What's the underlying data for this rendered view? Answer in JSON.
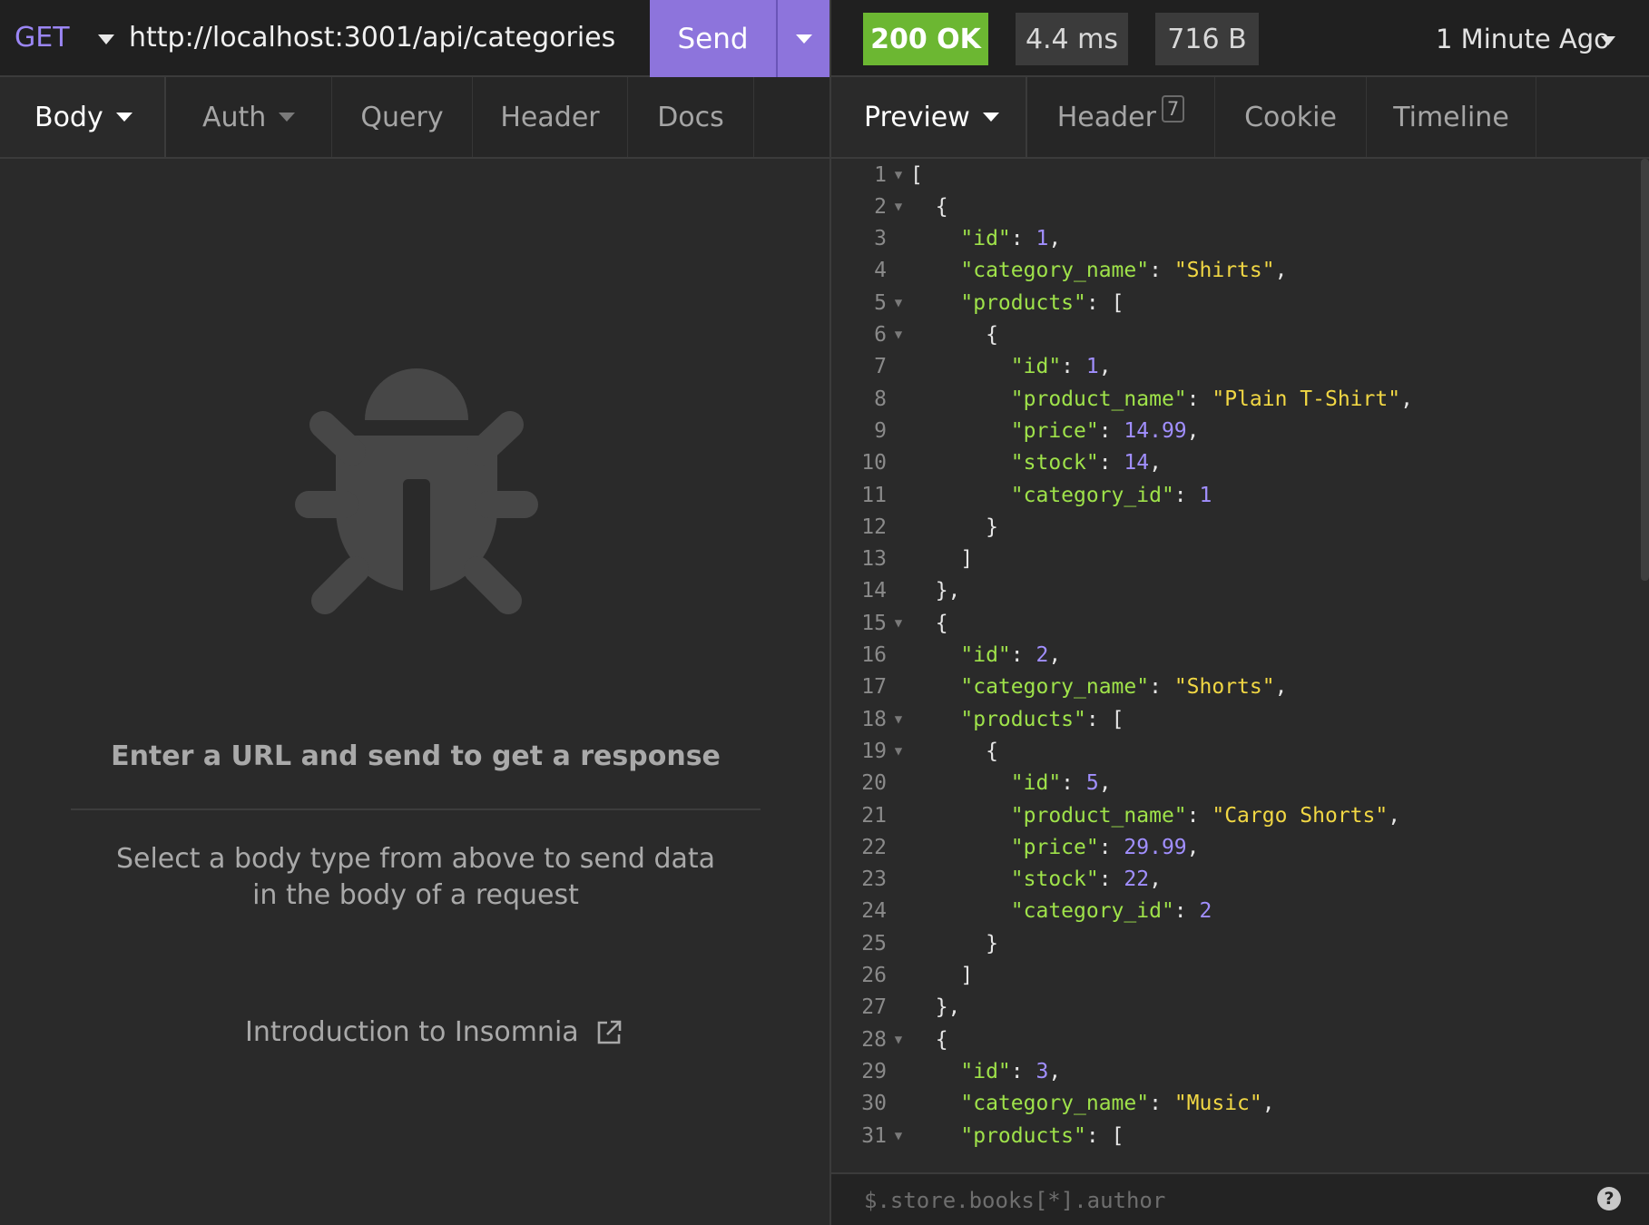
{
  "request": {
    "method": "GET",
    "url": "http://localhost:3001/api/categories",
    "send_label": "Send"
  },
  "response": {
    "status": "200 OK",
    "time": "4.4 ms",
    "size": "716 B",
    "time_ago": "1 Minute Ago"
  },
  "request_tabs": [
    "Body",
    "Auth",
    "Query",
    "Header",
    "Docs"
  ],
  "response_tabs": {
    "preview": "Preview",
    "header": "Header",
    "header_count": "7",
    "cookie": "Cookie",
    "timeline": "Timeline"
  },
  "empty_state": {
    "icon": "bug-icon",
    "title": "Enter a URL and send to get a response",
    "description": "Select a body type from above to send data in the body of a request",
    "link": "Introduction to Insomnia"
  },
  "filter": {
    "placeholder": "$.store.books[*].author"
  },
  "code_lines": [
    {
      "n": "1",
      "f": true,
      "t": [
        [
          "p",
          "["
        ]
      ]
    },
    {
      "n": "2",
      "f": true,
      "t": [
        [
          "p",
          "  {"
        ]
      ]
    },
    {
      "n": "3",
      "f": false,
      "t": [
        [
          "p",
          "    "
        ],
        [
          "k",
          "\"id\""
        ],
        [
          "p",
          ": "
        ],
        [
          "n",
          "1"
        ],
        [
          "p",
          ","
        ]
      ]
    },
    {
      "n": "4",
      "f": false,
      "t": [
        [
          "p",
          "    "
        ],
        [
          "k",
          "\"category_name\""
        ],
        [
          "p",
          ": "
        ],
        [
          "s",
          "\"Shirts\""
        ],
        [
          "p",
          ","
        ]
      ]
    },
    {
      "n": "5",
      "f": true,
      "t": [
        [
          "p",
          "    "
        ],
        [
          "k",
          "\"products\""
        ],
        [
          "p",
          ": ["
        ]
      ]
    },
    {
      "n": "6",
      "f": true,
      "t": [
        [
          "p",
          "      {"
        ]
      ]
    },
    {
      "n": "7",
      "f": false,
      "t": [
        [
          "p",
          "        "
        ],
        [
          "k",
          "\"id\""
        ],
        [
          "p",
          ": "
        ],
        [
          "n",
          "1"
        ],
        [
          "p",
          ","
        ]
      ]
    },
    {
      "n": "8",
      "f": false,
      "t": [
        [
          "p",
          "        "
        ],
        [
          "k",
          "\"product_name\""
        ],
        [
          "p",
          ": "
        ],
        [
          "s",
          "\"Plain T-Shirt\""
        ],
        [
          "p",
          ","
        ]
      ]
    },
    {
      "n": "9",
      "f": false,
      "t": [
        [
          "p",
          "        "
        ],
        [
          "k",
          "\"price\""
        ],
        [
          "p",
          ": "
        ],
        [
          "n",
          "14.99"
        ],
        [
          "p",
          ","
        ]
      ]
    },
    {
      "n": "10",
      "f": false,
      "t": [
        [
          "p",
          "        "
        ],
        [
          "k",
          "\"stock\""
        ],
        [
          "p",
          ": "
        ],
        [
          "n",
          "14"
        ],
        [
          "p",
          ","
        ]
      ]
    },
    {
      "n": "11",
      "f": false,
      "t": [
        [
          "p",
          "        "
        ],
        [
          "k",
          "\"category_id\""
        ],
        [
          "p",
          ": "
        ],
        [
          "n",
          "1"
        ]
      ]
    },
    {
      "n": "12",
      "f": false,
      "t": [
        [
          "p",
          "      }"
        ]
      ]
    },
    {
      "n": "13",
      "f": false,
      "t": [
        [
          "p",
          "    ]"
        ]
      ]
    },
    {
      "n": "14",
      "f": false,
      "t": [
        [
          "p",
          "  },"
        ]
      ]
    },
    {
      "n": "15",
      "f": true,
      "t": [
        [
          "p",
          "  {"
        ]
      ]
    },
    {
      "n": "16",
      "f": false,
      "t": [
        [
          "p",
          "    "
        ],
        [
          "k",
          "\"id\""
        ],
        [
          "p",
          ": "
        ],
        [
          "n",
          "2"
        ],
        [
          "p",
          ","
        ]
      ]
    },
    {
      "n": "17",
      "f": false,
      "t": [
        [
          "p",
          "    "
        ],
        [
          "k",
          "\"category_name\""
        ],
        [
          "p",
          ": "
        ],
        [
          "s",
          "\"Shorts\""
        ],
        [
          "p",
          ","
        ]
      ]
    },
    {
      "n": "18",
      "f": true,
      "t": [
        [
          "p",
          "    "
        ],
        [
          "k",
          "\"products\""
        ],
        [
          "p",
          ": ["
        ]
      ]
    },
    {
      "n": "19",
      "f": true,
      "t": [
        [
          "p",
          "      {"
        ]
      ]
    },
    {
      "n": "20",
      "f": false,
      "t": [
        [
          "p",
          "        "
        ],
        [
          "k",
          "\"id\""
        ],
        [
          "p",
          ": "
        ],
        [
          "n",
          "5"
        ],
        [
          "p",
          ","
        ]
      ]
    },
    {
      "n": "21",
      "f": false,
      "t": [
        [
          "p",
          "        "
        ],
        [
          "k",
          "\"product_name\""
        ],
        [
          "p",
          ": "
        ],
        [
          "s",
          "\"Cargo Shorts\""
        ],
        [
          "p",
          ","
        ]
      ]
    },
    {
      "n": "22",
      "f": false,
      "t": [
        [
          "p",
          "        "
        ],
        [
          "k",
          "\"price\""
        ],
        [
          "p",
          ": "
        ],
        [
          "n",
          "29.99"
        ],
        [
          "p",
          ","
        ]
      ]
    },
    {
      "n": "23",
      "f": false,
      "t": [
        [
          "p",
          "        "
        ],
        [
          "k",
          "\"stock\""
        ],
        [
          "p",
          ": "
        ],
        [
          "n",
          "22"
        ],
        [
          "p",
          ","
        ]
      ]
    },
    {
      "n": "24",
      "f": false,
      "t": [
        [
          "p",
          "        "
        ],
        [
          "k",
          "\"category_id\""
        ],
        [
          "p",
          ": "
        ],
        [
          "n",
          "2"
        ]
      ]
    },
    {
      "n": "25",
      "f": false,
      "t": [
        [
          "p",
          "      }"
        ]
      ]
    },
    {
      "n": "26",
      "f": false,
      "t": [
        [
          "p",
          "    ]"
        ]
      ]
    },
    {
      "n": "27",
      "f": false,
      "t": [
        [
          "p",
          "  },"
        ]
      ]
    },
    {
      "n": "28",
      "f": true,
      "t": [
        [
          "p",
          "  {"
        ]
      ]
    },
    {
      "n": "29",
      "f": false,
      "t": [
        [
          "p",
          "    "
        ],
        [
          "k",
          "\"id\""
        ],
        [
          "p",
          ": "
        ],
        [
          "n",
          "3"
        ],
        [
          "p",
          ","
        ]
      ]
    },
    {
      "n": "30",
      "f": false,
      "t": [
        [
          "p",
          "    "
        ],
        [
          "k",
          "\"category_name\""
        ],
        [
          "p",
          ": "
        ],
        [
          "s",
          "\"Music\""
        ],
        [
          "p",
          ","
        ]
      ]
    },
    {
      "n": "31",
      "f": true,
      "t": [
        [
          "p",
          "    "
        ],
        [
          "k",
          "\"products\""
        ],
        [
          "p",
          ": ["
        ]
      ]
    }
  ],
  "colors": {
    "accent": "#8d74dc",
    "status_ok": "#6cb732",
    "json_key": "#9fe24a",
    "json_string": "#f1d744",
    "json_number": "#a18fff"
  }
}
